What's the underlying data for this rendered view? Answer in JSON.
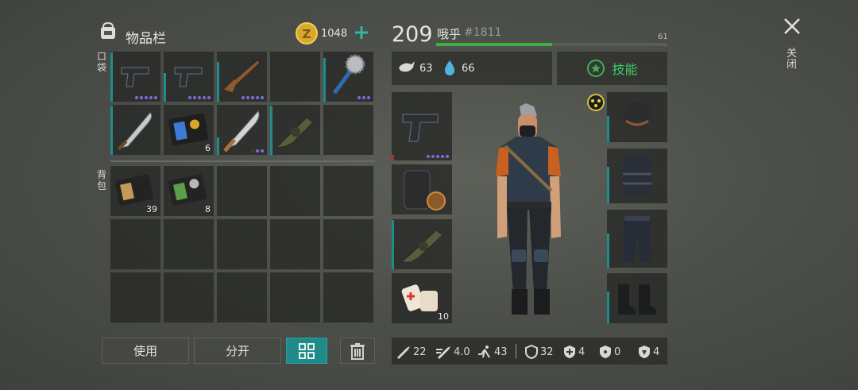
{
  "inventory": {
    "title": "物品栏",
    "coins": "1048",
    "pockets_label": "口袋",
    "backpack_label": "背包",
    "pocket_counts": {
      "item_6": "6"
    },
    "backpack_counts": {
      "item_1": "39",
      "item_2": "8"
    }
  },
  "buttons": {
    "use": "使用",
    "split": "分开"
  },
  "player": {
    "level": "209",
    "name": "哦乎",
    "id": "#1811",
    "xp_value": "61",
    "xp_fraction": 0.5,
    "hunger": "63",
    "thirst": "66",
    "skills_label": "技能"
  },
  "equipment": {
    "ammo_count": "10"
  },
  "stats": {
    "attack": "22",
    "speed": "4.0",
    "move": "43",
    "armor": "32",
    "cold": "4",
    "radiation": "0",
    "toxic": "4"
  },
  "close_label": "关闭",
  "colors": {
    "accent_teal": "#1f8c8c",
    "xp_green": "#3db03d",
    "rarity_purple": "#7c6bd8"
  }
}
